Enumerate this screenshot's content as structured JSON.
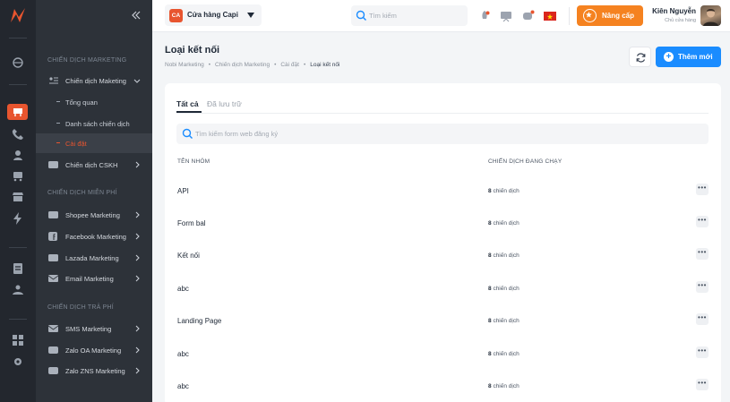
{
  "sidebar": {
    "section_marketing": "CHIẾN DỊCH MARKETING",
    "campaign_marketing": "Chiến dịch Maketing",
    "sub_overview": "Tổng quan",
    "sub_list": "Danh sách chiến dịch",
    "sub_settings": "Cài đặt",
    "campaign_cskh": "Chiến dịch CSKH",
    "section_free": "CHIẾN DỊCH MIỄN PHÍ",
    "shopee": "Shopee Marketing",
    "facebook": "Facebook Marketing",
    "lazada": "Lazada Marketing",
    "email": "Email Marketing",
    "section_paid": "CHIẾN DỊCH TRẢ PHÍ",
    "sms": "SMS Marketing",
    "zalo_oa": "Zalo OA Marketing",
    "zalo_zns": "Zalo ZNS Marketing"
  },
  "topbar": {
    "store_avatar": "CA",
    "store_name": "Cửa hàng Capi",
    "search_placeholder": "Tìm kiếm",
    "upgrade_label": "Nâng cấp",
    "user_name": "Kiên Nguyễn",
    "user_role": "Chủ cửa hàng"
  },
  "page": {
    "title": "Loại kết nối",
    "breadcrumbs": [
      "Nobi Marketing",
      "•",
      "Chiến dịch Marketing",
      "•",
      "Cài đặt",
      "•",
      "Loại kết nối"
    ],
    "add_button": "Thêm mới"
  },
  "card": {
    "tab_all": "Tất cả",
    "tab_archived": "Đã lưu trữ",
    "search_placeholder": "Tìm kiếm form web đăng ký",
    "col_group": "TÊN NHÓM",
    "col_running": "CHIẾN DỊCH ĐANG CHẠY",
    "more_label": "•••",
    "rows": [
      {
        "name": "API",
        "count": "8",
        "unit": "chiến dịch"
      },
      {
        "name": "Form bal",
        "count": "8",
        "unit": "chiến dịch"
      },
      {
        "name": "Kết nối",
        "count": "8",
        "unit": "chiến dịch"
      },
      {
        "name": "abc",
        "count": "8",
        "unit": "chiến dịch"
      },
      {
        "name": "Landing Page",
        "count": "8",
        "unit": "chiến dịch"
      },
      {
        "name": "abc",
        "count": "8",
        "unit": "chiến dịch"
      },
      {
        "name": "abc",
        "count": "8",
        "unit": "chiến dịch"
      }
    ]
  },
  "colors": {
    "accent": "#e8552f",
    "primary": "#1a8cff",
    "upgrade": "#f58220",
    "rail": "#23272e",
    "sidebar": "#2d3239"
  }
}
